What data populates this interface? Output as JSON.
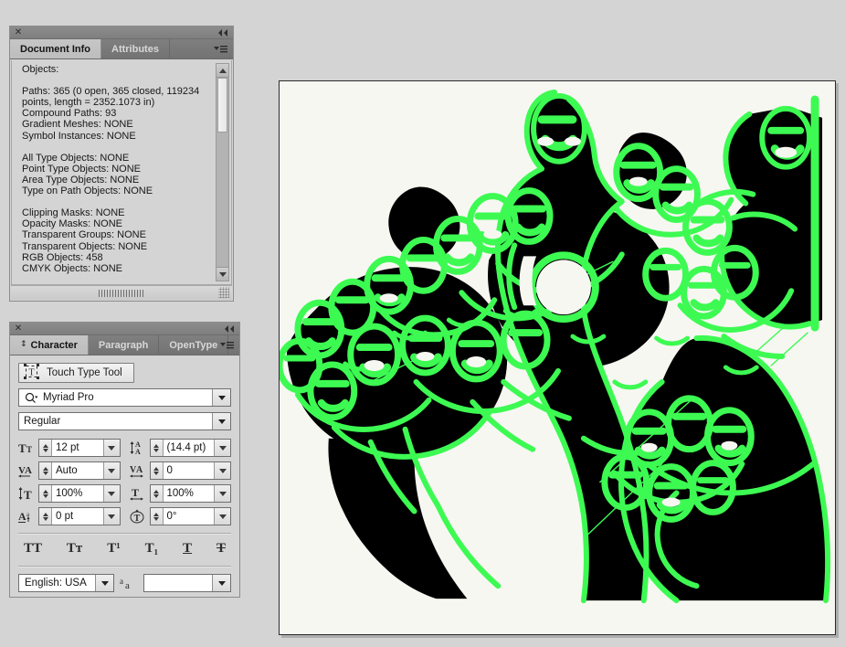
{
  "app": {
    "background_color": "#d4d4d4"
  },
  "doc_info_panel": {
    "title_close_icon": "close-icon",
    "collapse_icon": "collapse-panel-icon",
    "tabs": [
      {
        "label": "Document Info",
        "active": true
      },
      {
        "label": "Attributes",
        "active": false
      }
    ],
    "menu_icon": "panel-menu-icon",
    "content": "Objects:\n\nPaths: 365 (0 open, 365 closed, 119234\npoints, length = 2352.1073 in)\nCompound Paths: 93\nGradient Meshes: NONE\nSymbol Instances: NONE\n\nAll Type Objects: NONE\nPoint Type Objects: NONE\nArea Type Objects: NONE\nType on Path Objects: NONE\n\nClipping Masks: NONE\nOpacity Masks: NONE\nTransparent Groups: NONE\nTransparent Objects: NONE\nRGB Objects: 458\nCMYK Objects: NONE",
    "stats": {
      "objects_header": "Objects:",
      "paths": "365",
      "paths_open": "0",
      "paths_closed": "365",
      "points": "119234",
      "length": "2352.1073 in",
      "compound_paths": "93",
      "gradient_meshes": "NONE",
      "symbol_instances": "NONE",
      "all_type_objects": "NONE",
      "point_type_objects": "NONE",
      "area_type_objects": "NONE",
      "type_on_path_objects": "NONE",
      "clipping_masks": "NONE",
      "opacity_masks": "NONE",
      "transparent_groups": "NONE",
      "transparent_objects": "NONE",
      "rgb_objects": "458",
      "cmyk_objects": "NONE"
    },
    "scrollbar": {
      "up_icon": "scroll-up-arrow-icon",
      "down_icon": "scroll-down-arrow-icon"
    }
  },
  "character_panel": {
    "tabs": [
      {
        "label": "Character",
        "active": true
      },
      {
        "label": "Paragraph",
        "active": false
      },
      {
        "label": "OpenType",
        "active": false
      }
    ],
    "touch_type_tool": {
      "label": "Touch Type Tool",
      "icon": "touch-type-tool-icon"
    },
    "font_family": {
      "value": "Myriad Pro",
      "search_icon": "font-search-icon"
    },
    "font_style": {
      "value": "Regular"
    },
    "metrics": [
      {
        "name": "font-size",
        "icon": "font-size-icon",
        "value": "12 pt"
      },
      {
        "name": "leading",
        "icon": "leading-icon",
        "value": "(14.4 pt)"
      },
      {
        "name": "kerning",
        "icon": "kerning-icon",
        "value": "Auto"
      },
      {
        "name": "tracking",
        "icon": "tracking-icon",
        "value": "0"
      },
      {
        "name": "vertical-scale",
        "icon": "vertical-scale-icon",
        "value": "100%"
      },
      {
        "name": "horizontal-scale",
        "icon": "horizontal-scale-icon",
        "value": "100%"
      },
      {
        "name": "baseline-shift",
        "icon": "baseline-shift-icon",
        "value": "0 pt"
      },
      {
        "name": "character-rotation",
        "icon": "character-rotation-icon",
        "value": "0°"
      }
    ],
    "style_buttons": [
      {
        "name": "all-caps-button",
        "glyph": "TT"
      },
      {
        "name": "small-caps-button",
        "glyph": "Tт"
      },
      {
        "name": "superscript-button",
        "glyph": "T¹"
      },
      {
        "name": "subscript-button",
        "glyph": "T₁"
      },
      {
        "name": "underline-button",
        "glyph": "T"
      },
      {
        "name": "strikethrough-button",
        "glyph": "T"
      }
    ],
    "language": {
      "value": "English: USA"
    },
    "anti_aliasing": {
      "icon": "anti-aliasing-icon",
      "value": ""
    }
  },
  "artboard": {
    "name": "illustrator-artboard",
    "paper_color": "#f7f7f2",
    "fill_color": "#000000",
    "path_outline_color": "#3dfa52",
    "description": "Crowd illustration: many stylized figures, a large central figure with a circular medallion, rendered as black silhouette shapes with green vector path outlines showing selected paths."
  }
}
